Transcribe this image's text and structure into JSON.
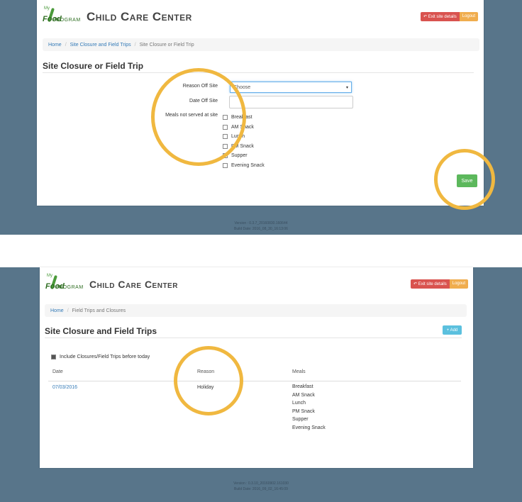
{
  "app": {
    "title": "Child Care Center",
    "logo_small": "My",
    "logo_food": "Food",
    "logo_program": "PROGRAM",
    "exit_label": "Exit site details",
    "logout_label": "Logout"
  },
  "colors": {
    "brand_green": "#2f6e22",
    "background_band": "#58758a",
    "highlight_circle": "#f0b840",
    "save": "#5cb85c",
    "add": "#5bc0de",
    "exit": "#d9534f",
    "logout": "#f0ad4e"
  },
  "form_screen": {
    "breadcrumb": [
      "Home",
      "Site Closure and Field Trips",
      "Site Closure or Field Trip"
    ],
    "title": "Site Closure or Field Trip",
    "reason_label": "Reason Off Site",
    "reason_value": "Choose",
    "date_label": "Date Off Site",
    "meals_label": "Meals not served at site",
    "meals": [
      "Breakfast",
      "AM Snack",
      "Lunch",
      "PM Snack",
      "Supper",
      "Evening Snack"
    ],
    "save_label": "Save",
    "version": "Version : 0.3.7_20160830.160644",
    "build_date": "Build Date: 2016_08_30_16:13:06"
  },
  "list_screen": {
    "breadcrumb": [
      "Home",
      "Field Trips and Closures"
    ],
    "title": "Site Closure and Field Trips",
    "add_label": "+ Add",
    "include_label": "Include Closures/Field Trips before today",
    "columns": [
      "Date",
      "Reason",
      "Meals"
    ],
    "rows": [
      {
        "date": "07/03/2016",
        "reason": "Holiday",
        "meals": [
          "Breakfast",
          "AM Snack",
          "Lunch",
          "PM Snack",
          "Supper",
          "Evening Snack"
        ]
      }
    ],
    "version": "Version : 0.3.10_20160902.161030",
    "build_date": "Build Date: 2016_09_02_16:45:09"
  }
}
